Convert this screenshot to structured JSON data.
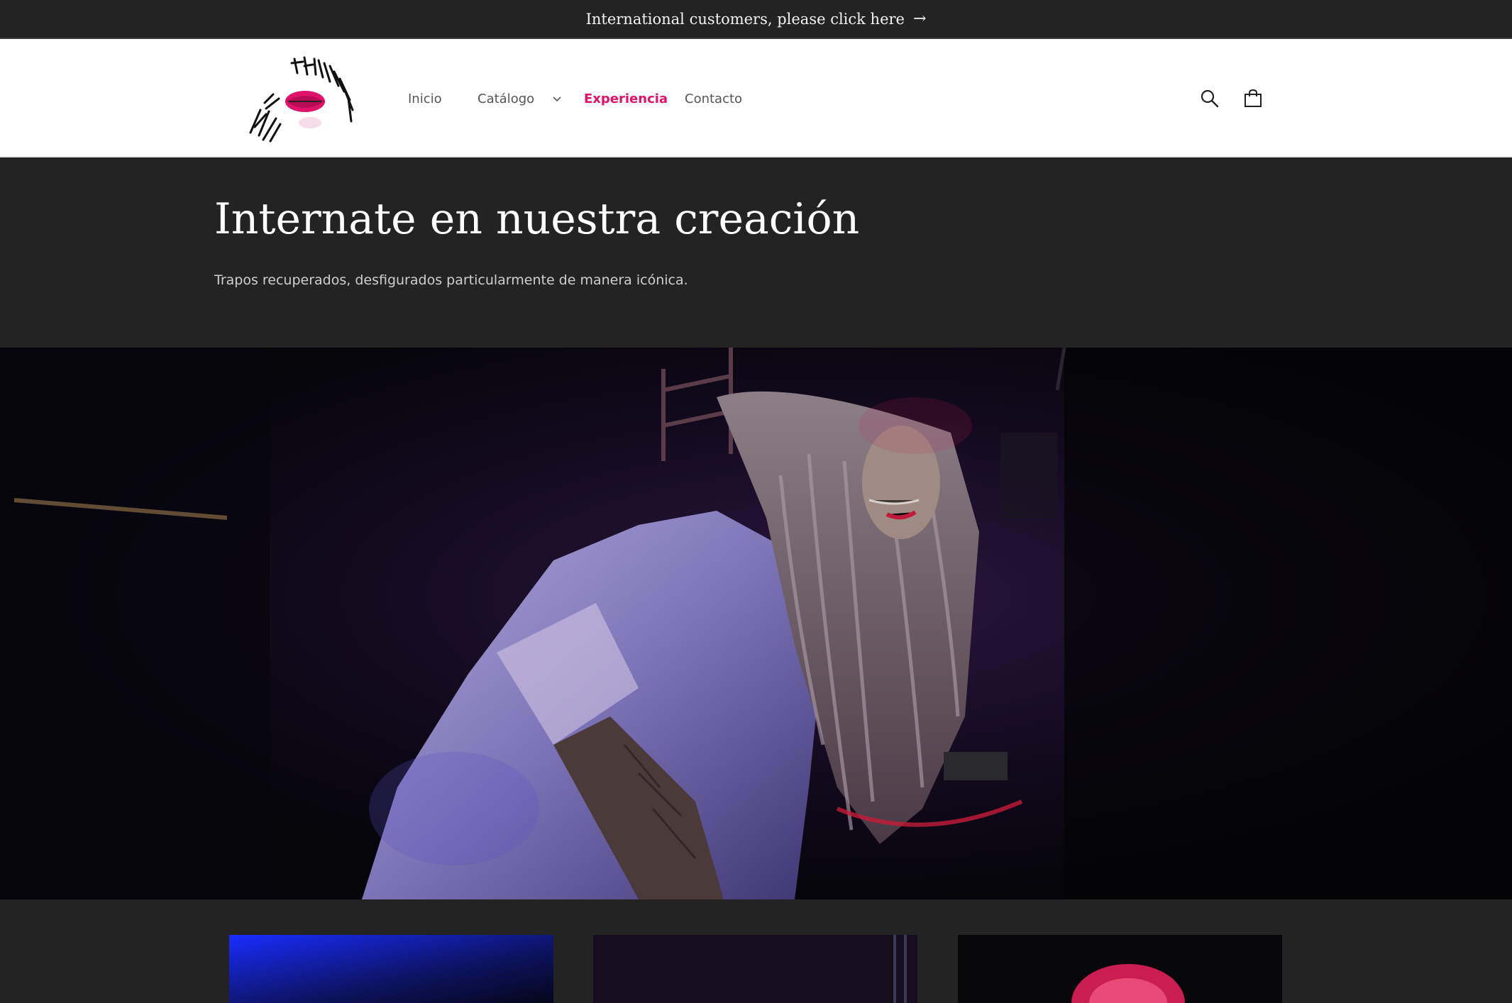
{
  "announcement": {
    "text": "International customers, please click here",
    "arrow": "→"
  },
  "header": {
    "logo_icon": "lips-graffiti-logo",
    "nav": [
      {
        "label": "Inicio"
      },
      {
        "label": "Catálogo",
        "icon": "chevron-down-icon"
      },
      {
        "label": "Experiencia",
        "active": true
      },
      {
        "label": "Contacto"
      }
    ],
    "icons": [
      "search-icon",
      "cart-icon"
    ]
  },
  "hero": {
    "title": "Internate en nuestra creación",
    "subtitle": "Trapos recuperados, desfigurados particularmente de manera icónica."
  },
  "colors": {
    "background": "#232323",
    "header_bg": "#ffffff",
    "accent": "#e0126a",
    "text_light": "#ffffff"
  }
}
